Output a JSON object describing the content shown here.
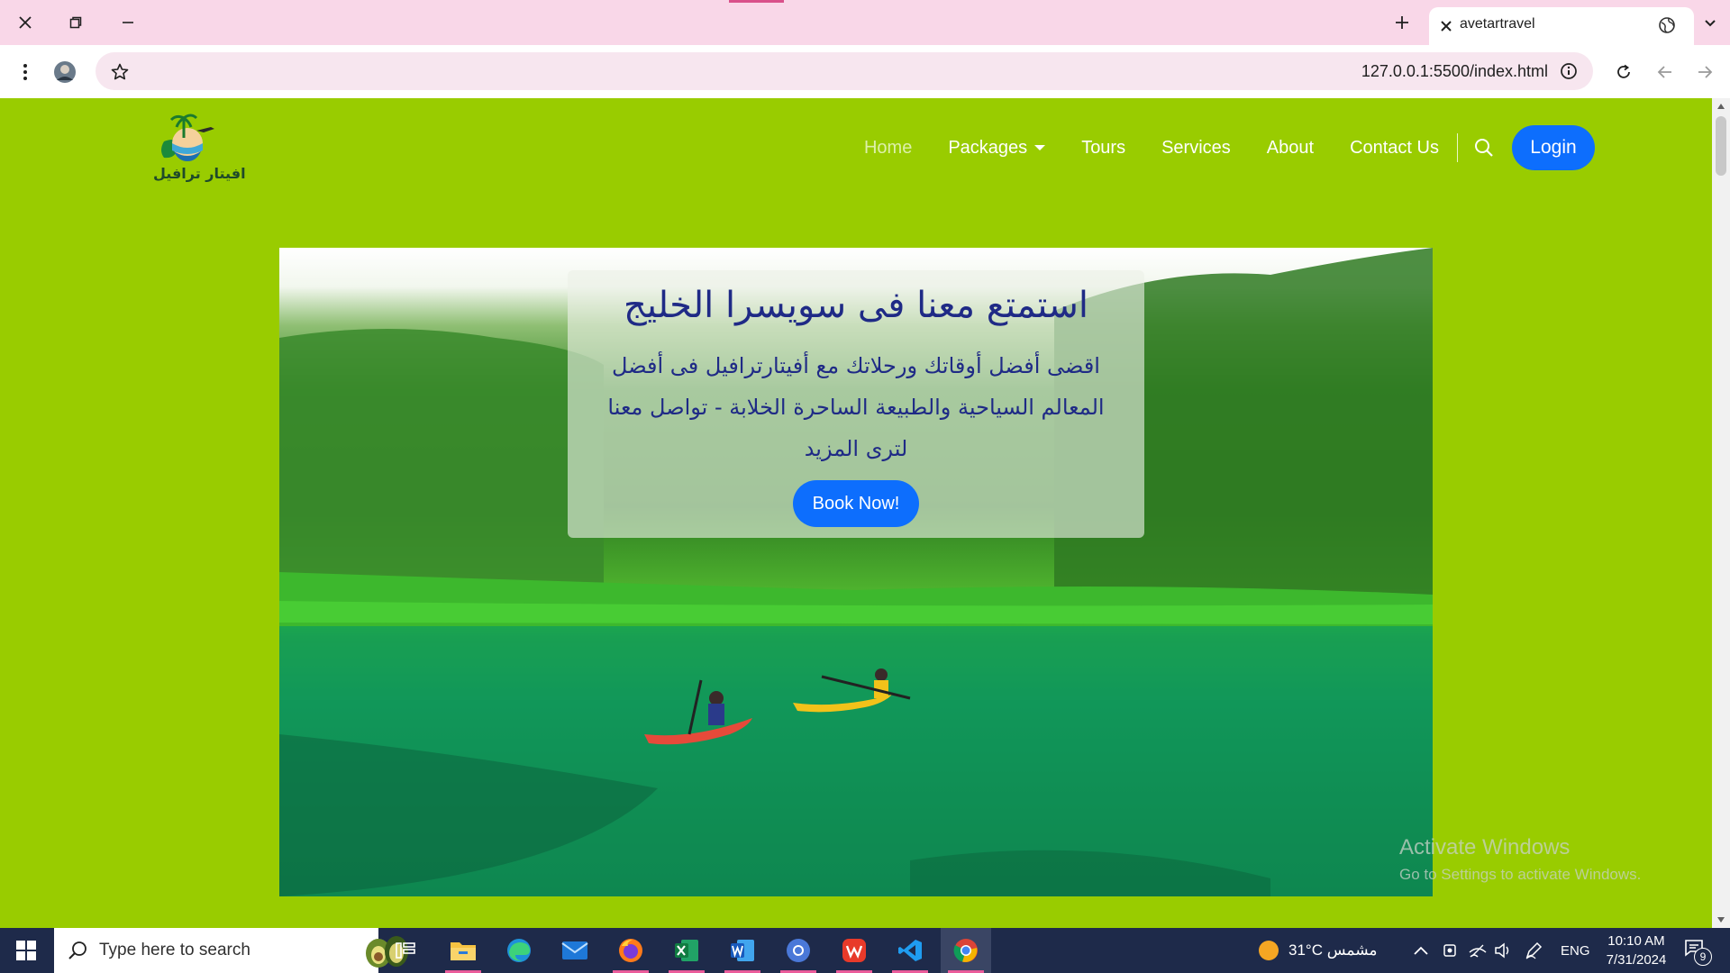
{
  "browser": {
    "tab_title": "avetartravel",
    "url": "127.0.0.1:5500/index.html"
  },
  "site": {
    "logo_text": "افيتار ترافيل",
    "nav": [
      {
        "label": "Home",
        "active": true
      },
      {
        "label": "Packages",
        "dropdown": true
      },
      {
        "label": "Tours"
      },
      {
        "label": "Services"
      },
      {
        "label": "About"
      },
      {
        "label": "Contact Us"
      }
    ],
    "login_label": "Login",
    "colors": {
      "background": "#99cc00",
      "primary": "#0d6efd",
      "heading": "#1f2a86"
    }
  },
  "hero": {
    "title": "استمتع معنا فى سويسرا الخليج",
    "subtitle": "اقضى أفضل أوقاتك ورحلاتك مع أفيتارترافيل فى أفضل المعالم السياحية والطبيعة الساحرة الخلابة - تواصل معنا لترى المزيد",
    "cta": "Book Now!"
  },
  "watermark": {
    "line1": "Activate Windows",
    "line2": "Go to Settings to activate Windows."
  },
  "taskbar": {
    "search_placeholder": "Type here to search",
    "weather": "31°C مشمس",
    "language": "ENG",
    "time": "10:10 AM",
    "date": "7/31/2024",
    "notifications": "9",
    "apps": [
      "task-view",
      "file-explorer",
      "edge",
      "mail",
      "firefox",
      "excel",
      "word",
      "chromium",
      "wps-office",
      "vscode",
      "chrome"
    ]
  }
}
